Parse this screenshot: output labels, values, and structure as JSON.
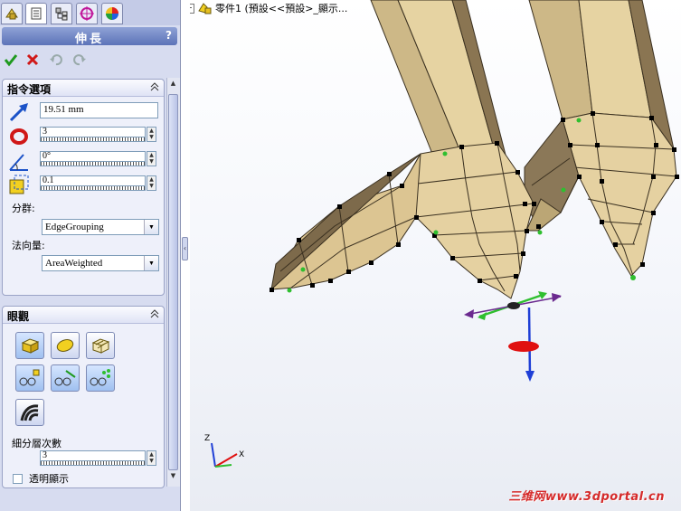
{
  "tabs": [
    {
      "icon": "feature-manager-icon"
    },
    {
      "icon": "property-manager-icon"
    },
    {
      "icon": "configuration-manager-icon"
    },
    {
      "icon": "dimxpert-icon"
    },
    {
      "icon": "display-manager-icon"
    }
  ],
  "panel": {
    "title": "伸長",
    "help": "?",
    "actions": [
      "ok-check-icon",
      "cancel-x-icon",
      "undo-icon",
      "redo-icon"
    ]
  },
  "options": {
    "header": "指令選項",
    "distance_value": "19.51 mm",
    "count_value": "3",
    "angle_value": "0°",
    "tolerance_value": "0.1",
    "grouping_label": "分群:",
    "grouping_value": "EdgeGrouping",
    "normal_label": "法向量:",
    "normal_value": "AreaWeighted"
  },
  "display": {
    "header": "眼觀",
    "subdiv_label": "細分層次數",
    "subdiv_value": "3",
    "transparent_label": "透明顯示"
  },
  "viewport": {
    "tree_text": "零件1 (預設<<預設>_顯示...",
    "axis_labels": {
      "z": "Z",
      "x": "X"
    },
    "watermark": "三维网www.3dportal.cn"
  },
  "colors": {
    "mesh_face": "#ddc995",
    "mesh_dark": "#7d6a4b",
    "vertex": "#000000",
    "handle_green": "#2fbf2f",
    "handle_purple": "#6b2a8f",
    "handle_red": "#e01010",
    "handle_blue": "#1f3fd6",
    "accent_title": "#5c73b8"
  }
}
